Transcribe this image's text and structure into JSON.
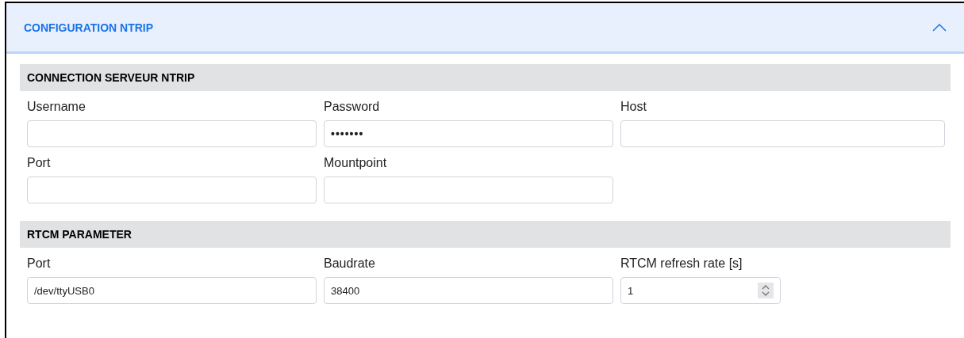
{
  "panel": {
    "title": "CONFIGURATION NTRIP",
    "expanded": true
  },
  "sections": [
    {
      "title": "CONNECTION SERVEUR NTRIP",
      "fields": [
        {
          "label": "Username",
          "kind": "text"
        },
        {
          "label": "Password",
          "kind": "password",
          "value": "•••••••"
        },
        {
          "label": "Host",
          "kind": "text"
        },
        {
          "label": "Port",
          "kind": "text"
        },
        {
          "label": "Mountpoint",
          "kind": "text"
        }
      ]
    },
    {
      "title": "RTCM PARAMETER",
      "fields": [
        {
          "label": "Port",
          "kind": "text",
          "value": "/dev/ttyUSB0"
        },
        {
          "label": "Baudrate",
          "kind": "text",
          "value": "38400"
        },
        {
          "label": "RTCM refresh rate [s]",
          "kind": "number",
          "value": "1"
        }
      ]
    }
  ]
}
